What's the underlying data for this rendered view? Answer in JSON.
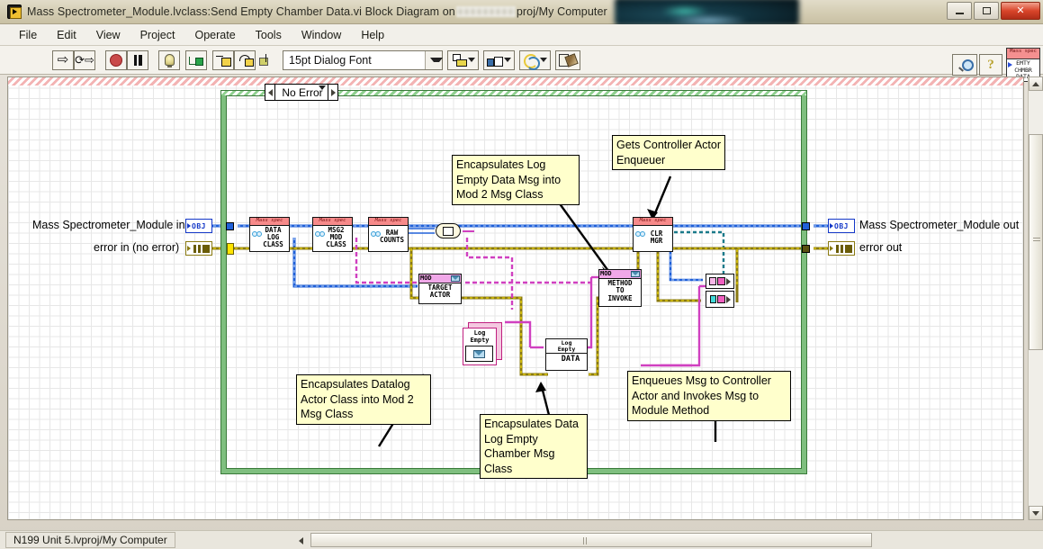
{
  "window": {
    "title_before": "Mass Spectrometer_Module.lvclass:Send Empty Chamber Data.vi Block Diagram on",
    "title_after": "proj/My Computer",
    "title_redacted": true,
    "buttons": {
      "minimize": "minimize",
      "maximize": "maximize",
      "close": "close"
    },
    "app_icon": "labview-vi-icon"
  },
  "menu": {
    "items": [
      "File",
      "Edit",
      "View",
      "Project",
      "Operate",
      "Tools",
      "Window",
      "Help"
    ]
  },
  "toolbar": {
    "run_label": "run-arrow",
    "run_continuous_label": "run-continuously",
    "abort_label": "abort-execution",
    "pause_label": "pause",
    "highlight_label": "highlight-execution",
    "retain_label": "retain-wire-values",
    "step_into_label": "step-into",
    "step_over_label": "step-over",
    "step_out_label": "step-out",
    "font_value": "15pt Dialog Font",
    "align_label": "align-objects",
    "distribute_label": "distribute-objects",
    "reorder_label": "reorder",
    "cleanup_label": "clean-up-diagram",
    "search_label": "search",
    "help_label": "context-help",
    "vi_icon": {
      "header": "Mass spec",
      "body": "EMTY\nCHMBR\nDATA"
    }
  },
  "diagram": {
    "case_structure": {
      "selector_value": "No Error"
    },
    "inputs": [
      {
        "label": "Mass Spectrometer_Module in",
        "terminal": "OBJ",
        "type": "object"
      },
      {
        "label": "error in (no error)",
        "terminal": "error-cluster",
        "type": "error"
      }
    ],
    "outputs": [
      {
        "label": "Mass Spectrometer_Module out",
        "terminal": "OBJ",
        "type": "object"
      },
      {
        "label": "error out",
        "terminal": "error-cluster",
        "type": "error"
      }
    ],
    "subvis": [
      {
        "name": "data-log-class",
        "header": "Mass spec",
        "body": "DATA\nLOG\nCLASS"
      },
      {
        "name": "msg2-mod-class",
        "header": "Mass spec",
        "body": "MSG2\nMOD\nCLASS"
      },
      {
        "name": "raw-counts",
        "header": "Mass spec",
        "body": "RAW\nCOUNTS"
      },
      {
        "name": "clr-mgr",
        "header": "Mass spec",
        "body": "CLR\nMGR"
      }
    ],
    "property_nodes": [
      {
        "name": "target-actor",
        "header": "MOD",
        "body": "TARGET\nACTOR"
      },
      {
        "name": "method-to-invoke",
        "header": "MOD",
        "body": "METHOD\nTO\nINVOKE"
      }
    ],
    "class_constant": {
      "name": "log-empty-constant",
      "label": "Log\nEmpty"
    },
    "accessor_node": {
      "name": "log-empty-data",
      "header": "Log\nEmpty",
      "body": "DATA"
    },
    "comments": [
      {
        "name": "comment-encapsulates-log-empty-data",
        "text": "Encapsulates Log Empty Data Msg into Mod 2 Msg Class"
      },
      {
        "name": "comment-gets-controller-actor-enqueuer",
        "text": "Gets Controller Actor Enqueuer"
      },
      {
        "name": "comment-encapsulates-datalog-actor",
        "text": "Encapsulates Datalog Actor Class into Mod 2 Msg Class"
      },
      {
        "name": "comment-encapsulates-data-log-empty-chamber",
        "text": "Encapsulates Data Log Empty Chamber Msg Class"
      },
      {
        "name": "comment-enqueues-msg-to-controller",
        "text": "Enqueues Msg to Controller Actor and Invokes Msg to Module Method"
      }
    ],
    "colors": {
      "object_wire": "#2060d8",
      "error_wire": "#8a7a10",
      "class_wire": "#d040c0",
      "structure_border": "#7fbf7f",
      "subvi_header": "#f78a8a",
      "mod_header": "#f0a8e8",
      "comment_bg": "#ffffcc"
    }
  },
  "statusbar": {
    "project": "N199 Unit 5.lvproj/My Computer"
  }
}
